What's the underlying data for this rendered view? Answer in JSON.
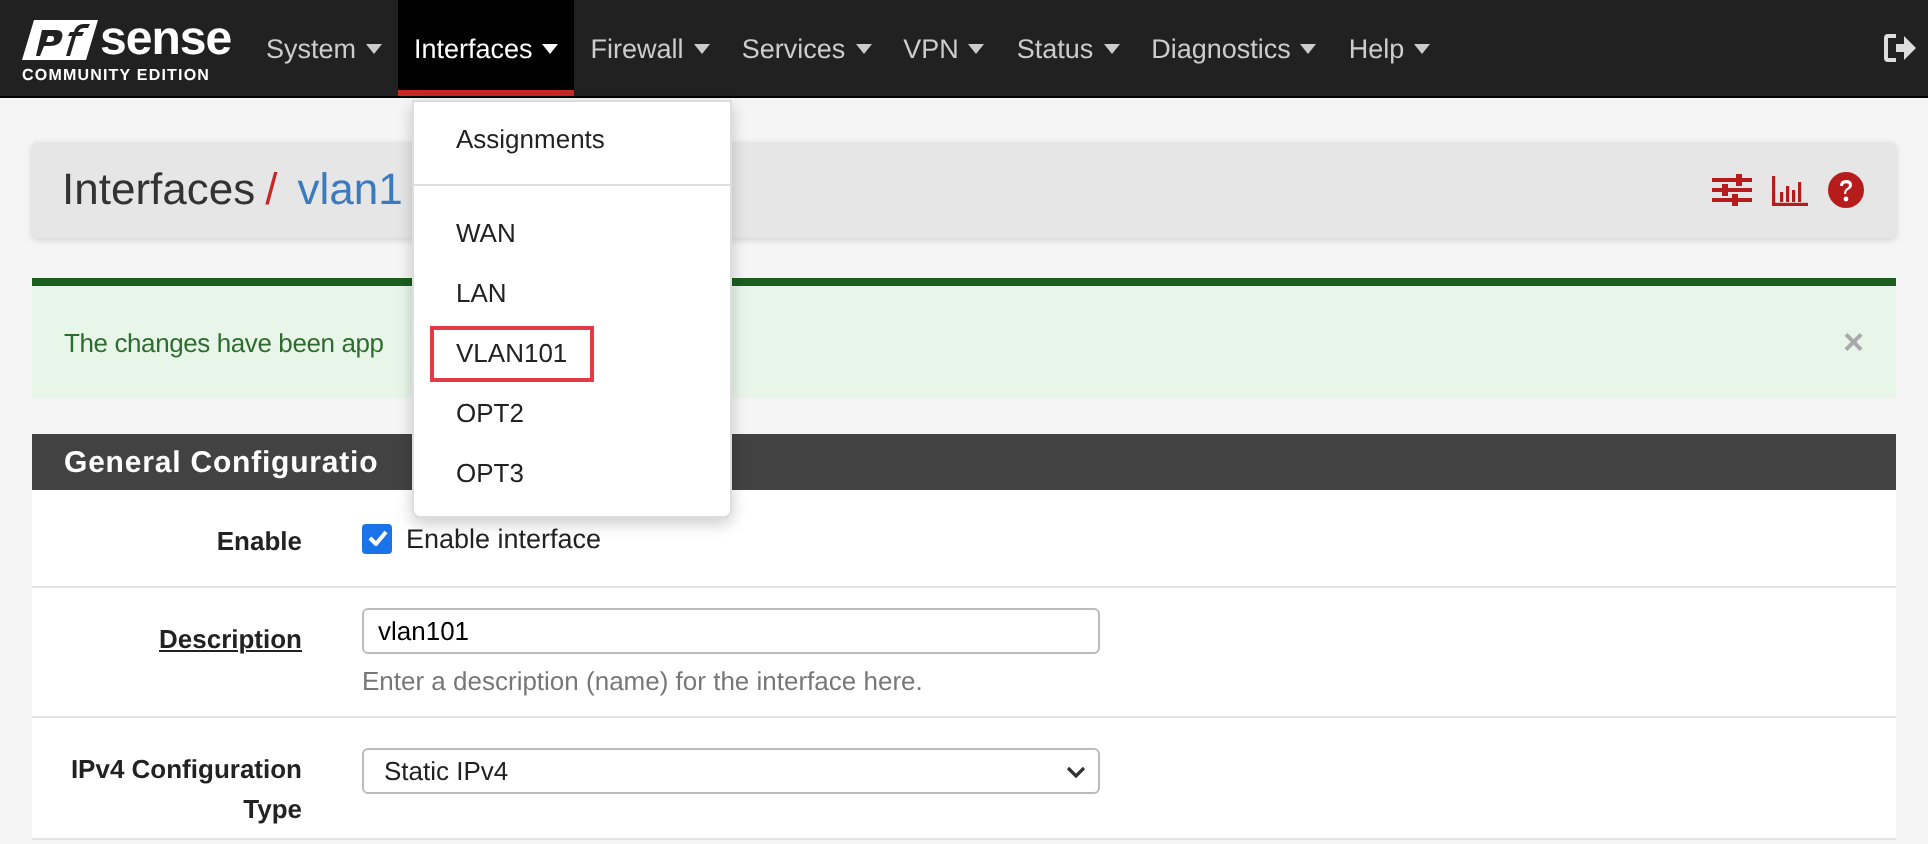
{
  "logo": {
    "brand": "sense",
    "tagline": "COMMUNITY EDITION"
  },
  "nav": [
    {
      "label": "System",
      "selected": false
    },
    {
      "label": "Interfaces",
      "selected": true
    },
    {
      "label": "Firewall",
      "selected": false
    },
    {
      "label": "Services",
      "selected": false
    },
    {
      "label": "VPN",
      "selected": false
    },
    {
      "label": "Status",
      "selected": false
    },
    {
      "label": "Diagnostics",
      "selected": false
    },
    {
      "label": "Help",
      "selected": false
    }
  ],
  "dropdown": [
    {
      "label": "Assignments",
      "kind": "item",
      "highlighted": false
    },
    {
      "kind": "divider"
    },
    {
      "label": "WAN",
      "kind": "item",
      "highlighted": false
    },
    {
      "label": "LAN",
      "kind": "item",
      "highlighted": false
    },
    {
      "label": "VLAN101",
      "kind": "item",
      "highlighted": true
    },
    {
      "label": "OPT2",
      "kind": "item",
      "highlighted": false
    },
    {
      "label": "OPT3",
      "kind": "item",
      "highlighted": false
    }
  ],
  "breadcrumb": {
    "section": "Interfaces",
    "separator": "/",
    "current": "vlan1"
  },
  "alert": {
    "message": "The changes have been app",
    "close": "×"
  },
  "panel": {
    "title": "General Configuratio",
    "rows": [
      {
        "kind": "checkbox",
        "label": "Enable",
        "checked": true,
        "text": "Enable interface"
      },
      {
        "kind": "text",
        "label": "Description",
        "value": "vlan101",
        "help": "Enter a description (name) for the interface here."
      },
      {
        "kind": "select",
        "label": "IPv4 Configuration Type",
        "value": "Static IPv4"
      }
    ]
  }
}
